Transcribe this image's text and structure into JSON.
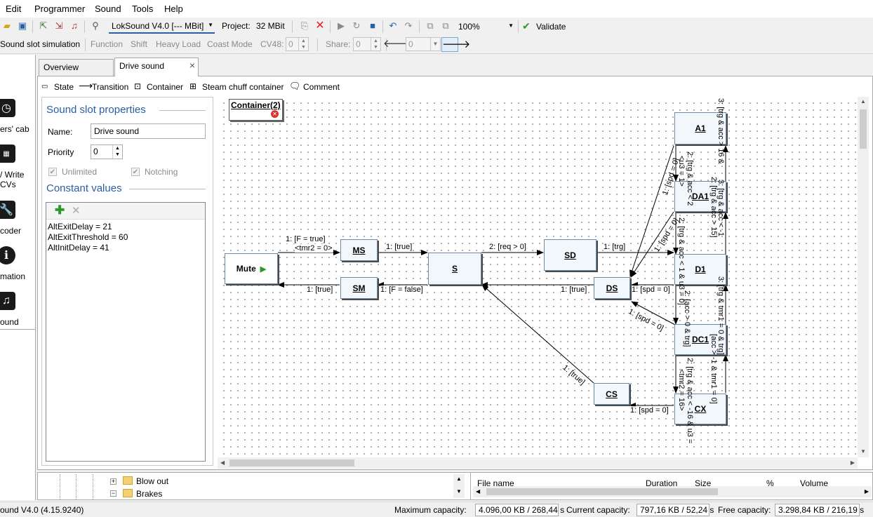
{
  "menu": [
    "Edit",
    "Programmer",
    "Sound",
    "Tools",
    "Help"
  ],
  "toolbar": {
    "decoder_select": "LokSound V4.0 [--- MBit]",
    "project_label": "Project:",
    "project_size": "32 MBit",
    "zoom": "100%",
    "validate": "Validate"
  },
  "toolbar2": {
    "simulation": "Sound slot simulation",
    "function": "Function",
    "shift": "Shift",
    "heavy_load": "Heavy Load",
    "coast_mode": "Coast Mode",
    "cv48_label": "CV48:",
    "cv48_value": "0",
    "share_label": "Share:",
    "share_value": "0",
    "nav_value": "0"
  },
  "leftbar": [
    {
      "label": "ers' cab",
      "icon": "clock-icon"
    },
    {
      "label": "/ Write\nCVs",
      "icon": "cv-icon"
    },
    {
      "label": "coder",
      "icon": "wrench-icon"
    },
    {
      "label": "mation",
      "icon": "info-icon"
    },
    {
      "label": "ound",
      "icon": "music-icon"
    }
  ],
  "tabs": [
    {
      "label": "Overview"
    },
    {
      "label": "Drive sound",
      "close": "×"
    }
  ],
  "editor_toolbar": {
    "state": "State",
    "transition": "Transition",
    "container": "Container",
    "steam": "Steam chuff container",
    "comment": "Comment"
  },
  "properties": {
    "title": "Sound slot properties",
    "name_label": "Name:",
    "name_value": "Drive sound",
    "priority_label": "Priority",
    "priority_value": "0",
    "unlimited": "Unlimited",
    "notching": "Notching",
    "constants_title": "Constant values",
    "constants": [
      "AltExitDelay = 21",
      "AltExitThreshold = 60",
      "AltInitDelay = 41"
    ]
  },
  "diagram": {
    "container_label": "Container(2)",
    "nodes": {
      "mute": "Mute",
      "ms": "MS",
      "sm": "SM",
      "s": "S",
      "sd": "SD",
      "ds": "DS",
      "cs": "CS",
      "a1": "A1",
      "da1": "DA1",
      "d1": "D1",
      "dc1": "DC1",
      "cx": "CX"
    },
    "edges": {
      "mute_ms_1": "1: [F = true]",
      "mute_ms_2": "<tmr2 = 0>",
      "ms_s": "1: [true]",
      "s_sd": "2: [req > 0]",
      "sd_d1": "1: [trg]",
      "sm_mute": "1: [true]",
      "s_sm": "1: [F = false]",
      "ds_s": "1: [true]",
      "d1_ds": "1: [spd = 0]",
      "dc1_ds": "1: [spd = 0]",
      "cs_s": "1: [true]",
      "cx_cs": "1: [spd = 0]",
      "a1_ds": "1: [spd = 0]",
      "da1_ds": "1: [spd = 0]",
      "v1": "2: [trg & acc < 2",
      "v2": "<u3 = 1>",
      "v3": "3: [trg & acc > 16 &",
      "v4": "2: [trg & acc > 15]",
      "v5": "2: [trg & acc < 1 & u3 = 0]",
      "v6": "3: [trg & acc < -1",
      "v7": "2: [acc > 0 & trg]",
      "v8": "3: [trg & tmr1 = 0 & trg]",
      "v9": "2: [trg & acc < -16 & u3 =",
      "v10": "<tmr2 = 16>",
      "v11": "[acc > -1 & tmr1 = 0]"
    }
  },
  "bottom": {
    "tree": [
      "Blow out",
      "Brakes"
    ],
    "columns": [
      "File name",
      "Duration",
      "Size",
      "%",
      "Volume"
    ]
  },
  "status": {
    "version": "ound V4.0 (4.15.9240)",
    "max_label": "Maximum capacity:",
    "max_value": "4.096,00 KB / 268,44 s",
    "cur_label": "Current capacity:",
    "cur_value": "797,16 KB / 52,24 s",
    "free_label": "Free capacity:",
    "free_value": "3.298,84 KB / 216,19 s"
  }
}
